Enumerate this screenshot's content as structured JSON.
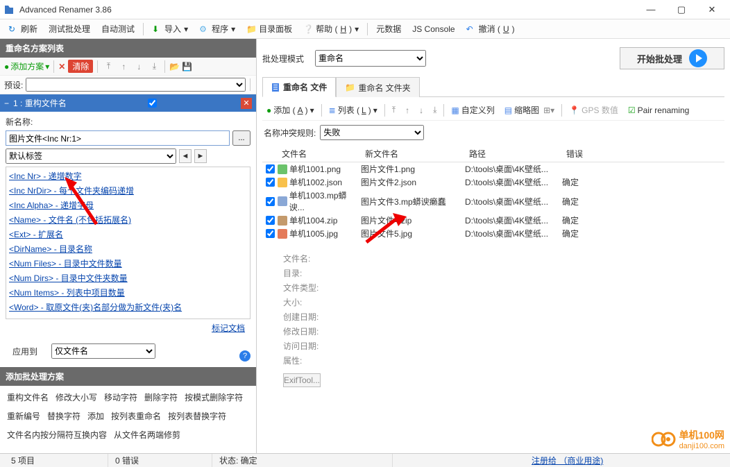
{
  "window": {
    "title": "Advanced Renamer 3.86"
  },
  "toolbar": {
    "refresh": "刷新",
    "test_batch": "测试批处理",
    "auto_test": "自动测试",
    "import": "导入",
    "program": "程序",
    "directory_panel": "目录面板",
    "help": "帮助 (",
    "help_key": "H",
    "help_after": ")",
    "metadata": "元数据",
    "js_console": "JS Console",
    "undo": "撤消 (",
    "undo_key": "U",
    "undo_after": ")"
  },
  "left": {
    "method_list_title": "重命名方案列表",
    "add_method": "添加方案",
    "clear": "清除",
    "preset_label": "预设:",
    "method_title": "1 : 重构文件名",
    "new_name_label": "新名称:",
    "new_name_value": "图片文件<Inc Nr:1>",
    "default_tag_label": "默认标签",
    "tags": [
      "<Inc Nr> - 递增数字",
      "<Inc NrDir> - 每个文件夹编码递增",
      "<Inc Alpha> - 递增字母",
      "<Name> - 文件名 (不包括拓展名)",
      "<Ext> - 扩展名",
      "<DirName> - 目录名称",
      "<Num Files> - 目录中文件数量",
      "<Num Dirs> - 目录中文件夹数量",
      "<Num Items> - 列表中项目数量",
      "<Word> - 取原文件(夹)名部分做为新文件(夹)名"
    ],
    "mark_doc": "标记文档",
    "apply_to_label": "应用到",
    "apply_to_value": "仅文件名",
    "add_batch_title": "添加批处理方案",
    "methods_row1": [
      "重构文件名",
      "修改大小写",
      "移动字符",
      "删除字符"
    ],
    "methods_row2": [
      "按模式删除字符",
      "重新编号",
      "替换字符",
      "添加",
      "按列表重命名"
    ],
    "methods_row3": [
      "按列表替换字符",
      "文件名内按分隔符互换内容"
    ],
    "methods_row4": [
      "从文件名两端修剪"
    ]
  },
  "right": {
    "batch_mode_label": "批处理模式",
    "batch_mode_value": "重命名",
    "start_button": "开始批处理",
    "tab_files": "重命名 文件",
    "tab_folders": "重命名 文件夹",
    "ft_add": "添加 (",
    "ft_add_key": "A",
    "ft_list": "列表 (",
    "ft_list_key": "L",
    "ft_after": ")",
    "ft_custom_cols": "自定义列",
    "ft_thumbnails": "缩略图",
    "ft_gps": "GPS 数值",
    "ft_pair": "Pair renaming",
    "conflict_label": "名称冲突规则:",
    "conflict_value": "失败",
    "cols": {
      "fn": "文件名",
      "new": "新文件名",
      "path": "路径",
      "err": "错误"
    },
    "rows": [
      {
        "ic": "ic-png",
        "fn": "单机1001.png",
        "new": "图片文件1.png",
        "path": "D:\\tools\\桌面\\4K壁纸...",
        "err": ""
      },
      {
        "ic": "ic-json",
        "fn": "单机1002.json",
        "new": "图片文件2.json",
        "path": "D:\\tools\\桌面\\4K壁纸...",
        "err": "确定"
      },
      {
        "ic": "ic-mp",
        "fn": "单机1003.mp蟒谀...",
        "new": "图片文件3.mp蟒谀癞蠢",
        "path": "D:\\tools\\桌面\\4K壁纸...",
        "err": "确定"
      },
      {
        "ic": "ic-zip",
        "fn": "单机1004.zip",
        "new": "图片文件4.zip",
        "path": "D:\\tools\\桌面\\4K壁纸...",
        "err": "确定"
      },
      {
        "ic": "ic-jpg",
        "fn": "单机1005.jpg",
        "new": "图片文件5.jpg",
        "path": "D:\\tools\\桌面\\4K壁纸...",
        "err": "确定"
      }
    ],
    "info": {
      "filename": "文件名:",
      "directory": "目录:",
      "filetype": "文件类型:",
      "size": "大小:",
      "created": "创建日期:",
      "modified": "修改日期:",
      "accessed": "访问日期:",
      "attrs": "属性:",
      "exif_btn": "ExifTool..."
    }
  },
  "status": {
    "items": "5 项目",
    "errors": "0 错误",
    "state": "状态: 确定",
    "register": "注册给 （商业用途)"
  },
  "watermark": {
    "brand": "单机100网",
    "url": "danji100.com"
  }
}
